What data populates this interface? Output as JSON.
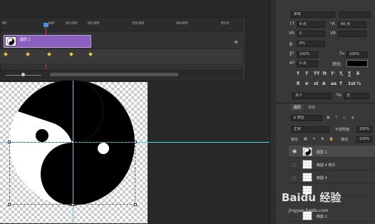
{
  "timeline": {
    "ruler_ticks": [
      "00",
      "",
      "00f",
      "01:00f",
      "",
      "02:00f",
      "",
      "03:00f",
      "",
      "04:00f",
      "",
      "05:0"
    ],
    "layer_label": "图层 1",
    "add_symbol": "+"
  },
  "character": {
    "font_family": "宋体",
    "size_value": "8 点",
    "leading_value": "60 点",
    "tracking_label": "VA",
    "kerning_value": "0",
    "vscale_value": "100%",
    "hscale_value": "100%",
    "baseline_value": "0 点",
    "color_label": "颜色:",
    "type_buttons": [
      "T",
      "T",
      "TT",
      "Tr",
      "T'",
      "T,",
      "T",
      "T"
    ],
    "fraction_buttons": [
      "fi",
      "σ",
      "st",
      "A",
      "aa",
      "T",
      "1st",
      "½"
    ],
    "language": "多个",
    "antialias": "无",
    "percent_field": "0%"
  },
  "layers": {
    "tabs": [
      "图层",
      "通道"
    ],
    "filter_kind": "ρ 类型",
    "blend_mode": "正常",
    "opacity_label": "不透明度:",
    "opacity_value": "100%",
    "lock_label": "锁定:",
    "fill_label": "填充:",
    "fill_value": "100%",
    "items": [
      {
        "name": "图层 1"
      },
      {
        "name": "椭圆 4 拷贝"
      },
      {
        "name": "椭圆 4"
      },
      {
        "name": ""
      },
      {
        "name": "椭圆 2"
      }
    ]
  },
  "watermark": {
    "brand": "Baidu 经验",
    "url": "jingyan.baidu.com"
  }
}
